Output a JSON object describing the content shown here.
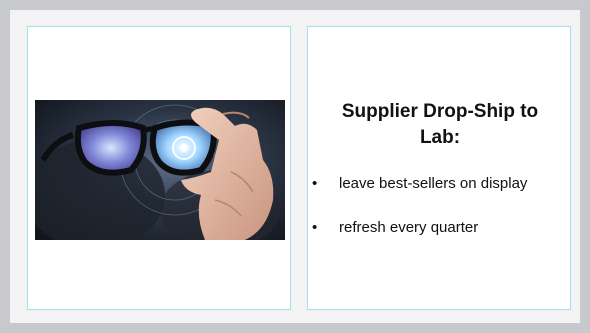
{
  "slide": {
    "background_color": "#c8c9cc",
    "panel_border_color": "#9fe1ec"
  },
  "left_panel": {
    "image_icon": "hand-holding-smart-glasses-photo"
  },
  "right_panel": {
    "title": "Supplier Drop-Ship to\nLab:",
    "bullet_char": "•",
    "bullets": [
      "leave best-sellers on display",
      "refresh every quarter"
    ]
  }
}
